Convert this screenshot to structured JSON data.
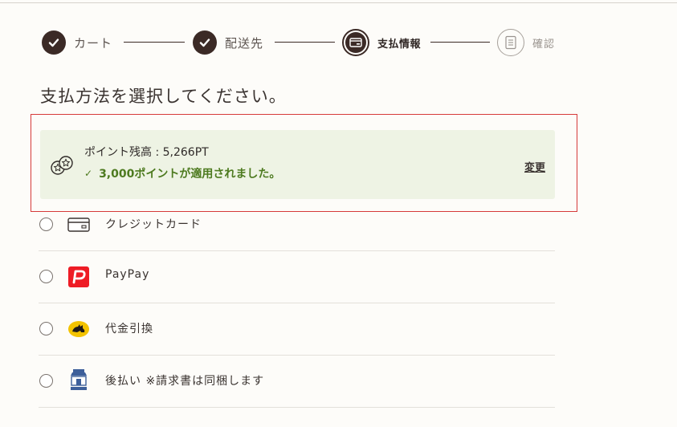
{
  "stepper": {
    "steps": [
      {
        "label": "カート",
        "state": "done"
      },
      {
        "label": "配送先",
        "state": "done"
      },
      {
        "label": "支払情報",
        "state": "current"
      },
      {
        "label": "確認",
        "state": "todo"
      }
    ]
  },
  "page": {
    "title": "支払方法を選択してください。"
  },
  "points": {
    "balance_text": "ポイント残高 : 5,266PT",
    "applied_text": "3,000ポイントが適用されました。",
    "change_label": "変更",
    "icon": "coins-icon"
  },
  "payment_methods": [
    {
      "label": "クレジットカード",
      "icon": "credit-card-icon"
    },
    {
      "label": "PayPay",
      "icon": "paypay-logo-icon"
    },
    {
      "label": "代金引換",
      "icon": "yamato-cat-icon"
    },
    {
      "label": "後払い ※請求書は同梱します",
      "icon": "convenience-store-icon"
    }
  ],
  "colors": {
    "accent_dark": "#3b2a26",
    "points_bg": "#eef3e4",
    "points_green": "#4d7a1f",
    "highlight_red": "#d63a3a",
    "paypay_red": "#ee1c25",
    "yamato_yellow": "#f3c300"
  }
}
